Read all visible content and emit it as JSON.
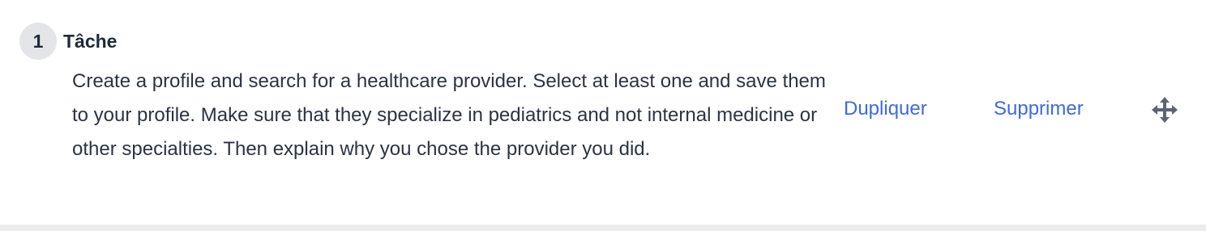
{
  "task": {
    "number": "1",
    "title": "Tâche",
    "description": "Create a profile and search for a healthcare provider. Select at least one and save them to your profile. Make sure that they specialize in pediatrics and not internal medicine or other specialties. Then explain why you chose the provider you did."
  },
  "actions": {
    "duplicate_label": "Dupliquer",
    "delete_label": "Supprimer",
    "drag_icon": "move-arrows-icon"
  },
  "colors": {
    "link": "#3d6ae0",
    "badge_bg": "#e3e5e9",
    "text": "#2b3442"
  }
}
